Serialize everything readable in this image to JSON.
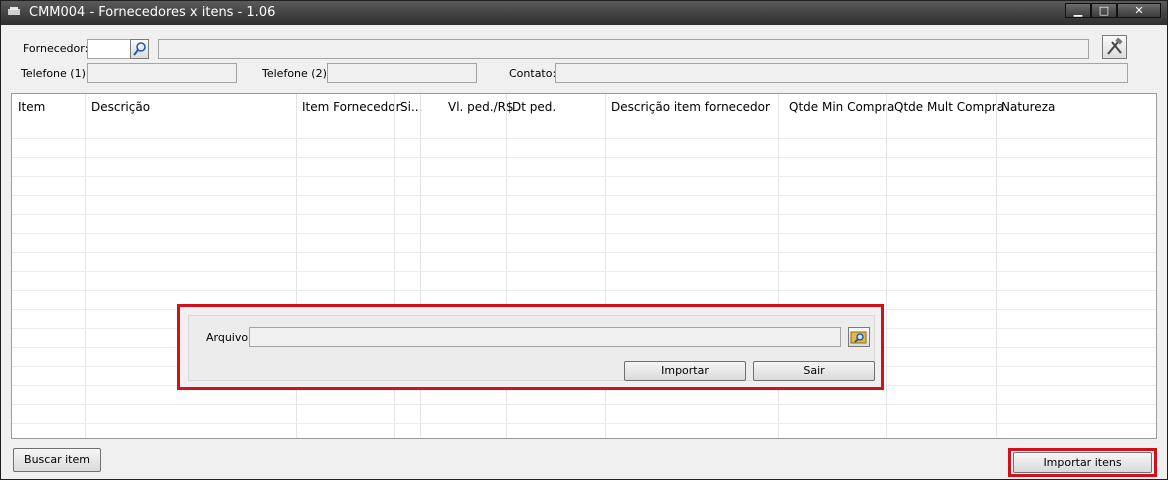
{
  "window": {
    "title": "CMM004 - Fornecedores x itens - 1.06",
    "controls": [
      "▁",
      "□",
      "✕"
    ]
  },
  "header": {
    "fornecedor_label": "Fornecedor:",
    "telefone1_label": "Telefone (1):",
    "telefone2_label": "Telefone (2):",
    "contato_label": "Contato:"
  },
  "grid": {
    "columns": [
      "Item",
      "Descrição",
      "Item Fornecedor",
      "Si...",
      "Vl. ped./R$",
      "Dt ped.",
      "Descrição item fornecedor",
      "Qtde Min Compra",
      "Qtde Mult Compra",
      "Natureza"
    ]
  },
  "import_dialog": {
    "arquivo_label": "Arquivo:",
    "importar_label": "Importar",
    "sair_label": "Sair"
  },
  "footer": {
    "buscar_item_label": "Buscar item",
    "importar_itens_label": "Importar itens"
  },
  "colors": {
    "highlight": "#d0101b",
    "titlebar": "#3a3a3a"
  }
}
